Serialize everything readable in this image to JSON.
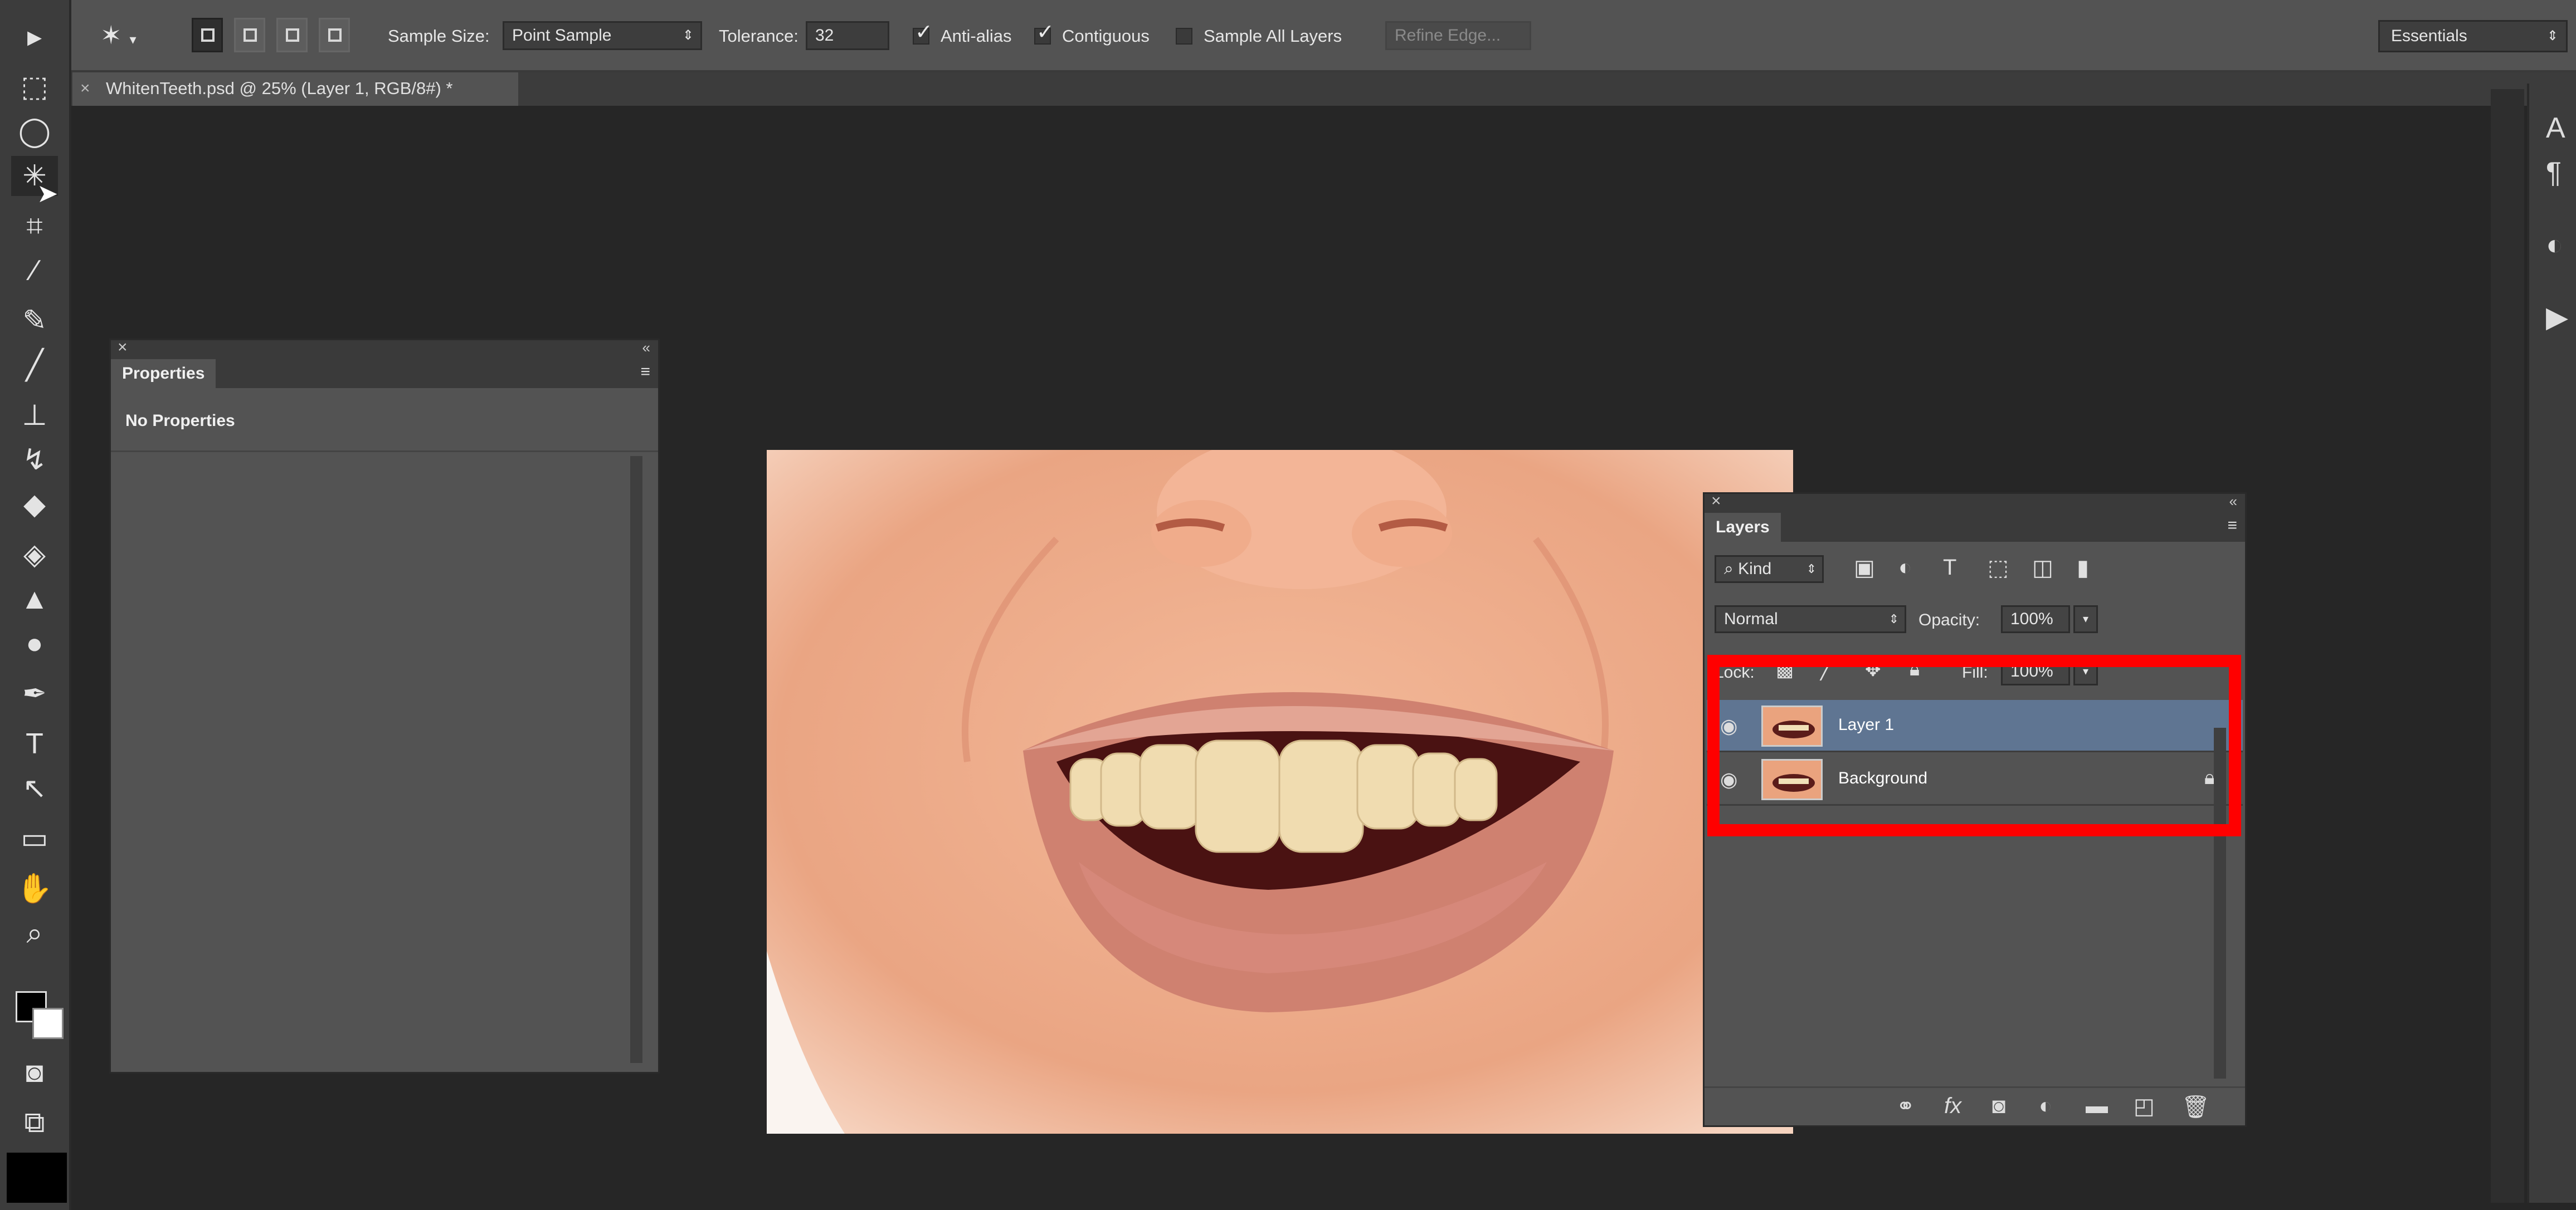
{
  "options_bar": {
    "sample_size_label": "Sample Size:",
    "sample_size_value": "Point Sample",
    "tolerance_label": "Tolerance:",
    "tolerance_value": "32",
    "anti_alias_label": "Anti-alias",
    "contiguous_label": "Contiguous",
    "sample_all_layers_label": "Sample All Layers",
    "refine_edge_label": "Refine Edge...",
    "workspace_value": "Essentials"
  },
  "document_tab": {
    "title": "WhitenTeeth.psd @ 25% (Layer 1, RGB/8#) *",
    "close_glyph": "×"
  },
  "properties_panel": {
    "tab_label": "Properties",
    "content_text": "No Properties"
  },
  "layers_panel": {
    "tab_label": "Layers",
    "filter_kind": "Kind",
    "blend_mode": "Normal",
    "opacity_label": "Opacity:",
    "opacity_value": "100%",
    "lock_label": "Lock:",
    "fill_label": "Fill:",
    "fill_value": "100%",
    "layers": [
      {
        "name": "Layer 1",
        "selected": true,
        "locked": false
      },
      {
        "name": "Background",
        "selected": false,
        "locked": true
      }
    ]
  },
  "icons": {
    "toolbar": [
      "move-icon",
      "marquee-icon",
      "lasso-icon",
      "magic-wand-icon",
      "crop-icon",
      "eyedropper-icon",
      "healing-brush-icon",
      "brush-icon",
      "clone-stamp-icon",
      "history-brush-icon",
      "eraser-icon",
      "paint-bucket-icon",
      "blur-icon",
      "dodge-icon",
      "pen-icon",
      "type-icon",
      "path-selection-icon",
      "rectangle-icon",
      "hand-icon",
      "zoom-icon",
      "quick-mask-icon",
      "screen-mode-icon"
    ],
    "right_dock": [
      "character-icon",
      "paragraph-icon",
      "adjustment-icon",
      "play-icon"
    ]
  },
  "colors": {
    "highlight_box": "#ff0000",
    "selected_layer": "#5f7592",
    "foreground": "#000000",
    "background": "#ffffff"
  }
}
